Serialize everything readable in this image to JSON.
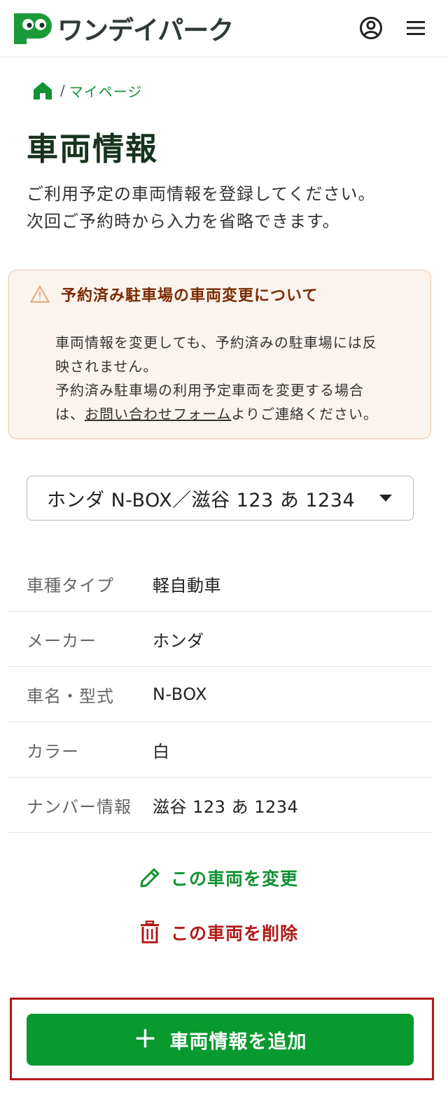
{
  "header": {
    "logo_text": "ワンデイパーク",
    "brand_color": "#1a9a3a"
  },
  "breadcrumb": {
    "separator": "/",
    "link": "マイページ"
  },
  "page": {
    "title": "車両情報",
    "intro_line1": "ご利用予定の車両情報を登録してください。",
    "intro_line2": "次回ご予約時から入力を省略できます。"
  },
  "notice": {
    "title": "予約済み駐車場の車両変更について",
    "line1": "車両情報を変更しても、予約済みの駐車場には反",
    "line2": "映されません。",
    "line3": "予約済み駐車場の利用予定車両を変更する場合",
    "line4_prefix": "は、",
    "link": "お問い合わせフォーム",
    "line4_suffix": "よりご連絡ください。"
  },
  "vehicle_select": {
    "selected": "ホンダ N-BOX／滋谷 123 あ 1234"
  },
  "details": [
    {
      "label": "車種タイプ",
      "value": "軽自動車"
    },
    {
      "label": "メーカー",
      "value": "ホンダ"
    },
    {
      "label": "車名・型式",
      "value": "N-BOX"
    },
    {
      "label": "カラー",
      "value": "白"
    },
    {
      "label": "ナンバー情報",
      "value": "滋谷 123 あ 1234"
    }
  ],
  "actions": {
    "edit_label": "この車両を変更",
    "delete_label": "この車両を削除"
  },
  "add_button": {
    "plus": "＋",
    "label": "車両情報を追加"
  },
  "colors": {
    "green": "#08992f",
    "red": "#b31a1a",
    "notice_bg": "#fbf4ee",
    "notice_border": "#f0c3a8"
  }
}
